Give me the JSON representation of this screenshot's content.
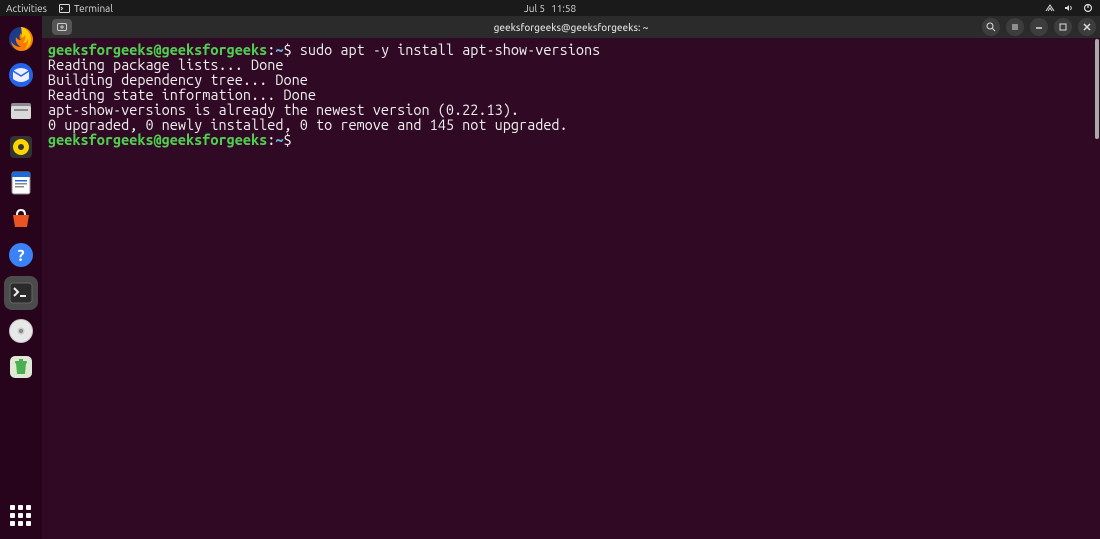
{
  "topbar": {
    "activities": "Activities",
    "terminal": "Terminal",
    "date": "Jul 5",
    "time": "11:58"
  },
  "dock": {
    "icons": [
      "firefox-icon",
      "thunderbird-icon",
      "files-icon",
      "rhythmbox-icon",
      "libreoffice-writer-icon",
      "software-center-icon",
      "help-icon",
      "terminal-icon",
      "disc-icon",
      "trash-icon"
    ]
  },
  "window": {
    "title": "geeksforgeeks@geeksforgeeks: ~"
  },
  "terminal": {
    "prompt": {
      "user": "geeksforgeeks@geeksforgeeks",
      "sep": ":",
      "path": "~",
      "symbol": "$ "
    },
    "command": "sudo apt -y install apt-show-versions",
    "output": [
      "Reading package lists... Done",
      "Building dependency tree... Done",
      "Reading state information... Done",
      "apt-show-versions is already the newest version (0.22.13).",
      "0 upgraded, 0 newly installed, 0 to remove and 145 not upgraded."
    ]
  }
}
